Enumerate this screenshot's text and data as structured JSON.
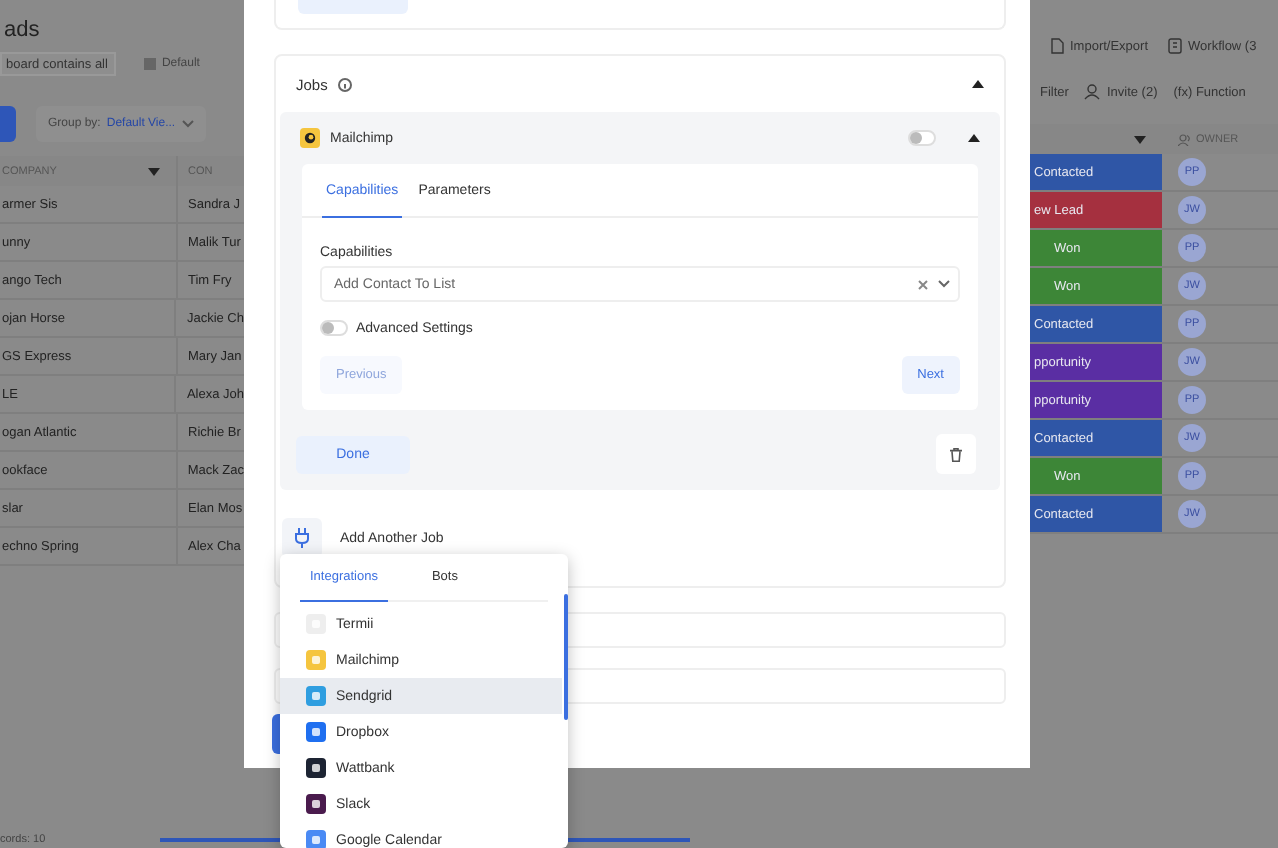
{
  "board": {
    "title": "ads",
    "filter_field": "board contains all",
    "view": "Default",
    "group_by": {
      "label": "Group by:",
      "value": "Default Vie..."
    },
    "actions": [
      {
        "label": "Import/Export"
      },
      {
        "label": "Workflow (3"
      }
    ],
    "tools": [
      {
        "label": "Filter"
      },
      {
        "label": "Invite (2)"
      },
      {
        "label": "(fx) Function"
      }
    ]
  },
  "table": {
    "columns": [
      "COMPANY",
      "CON",
      "OWNER"
    ],
    "rows": [
      {
        "company": "armer Sis",
        "contact": "Sandra J",
        "status": "Contacted",
        "color": "#2f56a6",
        "owner": "PP"
      },
      {
        "company": "unny",
        "contact": "Malik Tur",
        "status": "ew Lead",
        "color": "#a5303f",
        "owner": "JW"
      },
      {
        "company": "ango Tech",
        "contact": "Tim Fry",
        "status": "Won",
        "color": "#3d8637",
        "owner": "PP"
      },
      {
        "company": "ojan Horse",
        "contact": "Jackie Ch",
        "status": "Won",
        "color": "#3d8637",
        "owner": "JW"
      },
      {
        "company": "GS Express",
        "contact": "Mary Jan",
        "status": "Contacted",
        "color": "#2f56a6",
        "owner": "PP"
      },
      {
        "company": "LE",
        "contact": "Alexa Joh",
        "status": "pportunity",
        "color": "#5a2ea3",
        "owner": "JW"
      },
      {
        "company": "ogan Atlantic",
        "contact": "Richie Br",
        "status": "pportunity",
        "color": "#5a2ea3",
        "owner": "PP"
      },
      {
        "company": "ookface",
        "contact": "Mack Zac",
        "status": "Contacted",
        "color": "#2f56a6",
        "owner": "JW"
      },
      {
        "company": "slar",
        "contact": "Elan Mos",
        "status": "Won",
        "color": "#3d8637",
        "owner": "PP"
      },
      {
        "company": "echno Spring",
        "contact": "Alex Cha",
        "status": "Contacted",
        "color": "#2f56a6",
        "owner": "JW"
      }
    ]
  },
  "footer": {
    "records": "cords: 10"
  },
  "modal": {
    "jobs": {
      "title": "Jobs",
      "expanded": true,
      "job": {
        "name": "Mailchimp",
        "enabled": false,
        "expanded": true,
        "tabs": [
          {
            "label": "Capabilities",
            "selected": true
          },
          {
            "label": "Parameters",
            "selected": false
          }
        ],
        "capabilities_label": "Capabilities",
        "capability": "Add Contact To List",
        "advanced_settings": {
          "label": "Advanced Settings",
          "on": false
        },
        "nav_buttons": [
          {
            "label": "Previous",
            "disabled": true
          },
          {
            "label": "Next",
            "disabled": false
          }
        ],
        "done": "Done"
      },
      "add_job": "Add Another Job"
    }
  },
  "dropdown": {
    "tabs": [
      {
        "label": "Integrations",
        "selected": true
      },
      {
        "label": "Bots",
        "selected": false
      }
    ],
    "items": [
      {
        "name": "Termii",
        "color": "#eeeeee",
        "highlighted": false
      },
      {
        "name": "Mailchimp",
        "color": "#f5c53f",
        "highlighted": false
      },
      {
        "name": "Sendgrid",
        "color": "#2f9ee0",
        "highlighted": true
      },
      {
        "name": "Dropbox",
        "color": "#1f6ff0",
        "highlighted": false
      },
      {
        "name": "Wattbank",
        "color": "#1d2433",
        "highlighted": false
      },
      {
        "name": "Slack",
        "color": "#4a1b4d",
        "highlighted": false
      },
      {
        "name": "Google Calendar",
        "color": "#4a8af4",
        "highlighted": false
      }
    ]
  }
}
